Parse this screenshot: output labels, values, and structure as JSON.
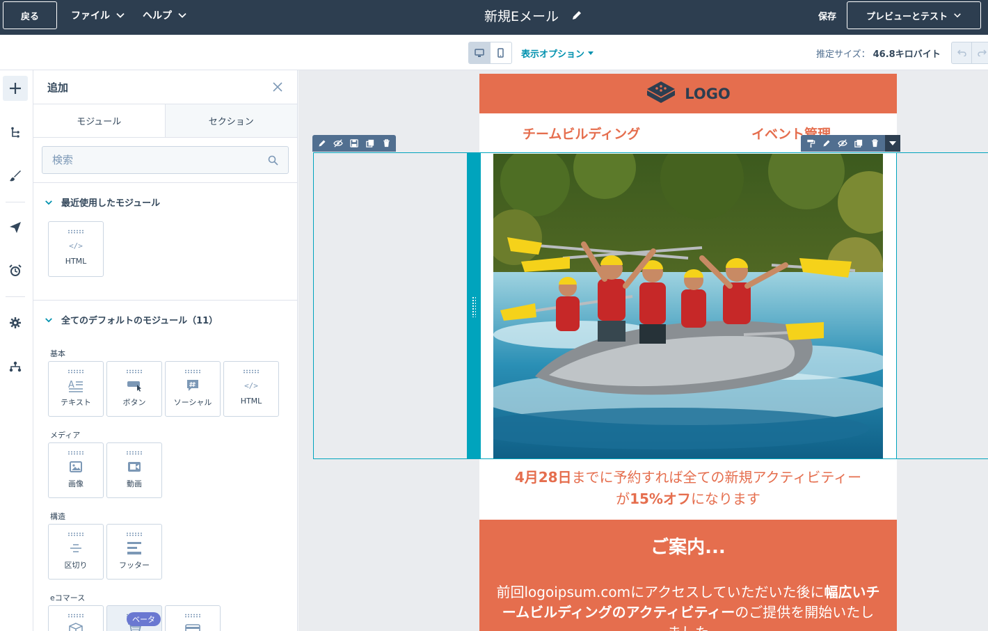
{
  "topbar": {
    "back_label": "戻る",
    "file_menu": "ファイル",
    "help_menu": "ヘルプ",
    "title": "新規Eメール",
    "save_label": "保存",
    "preview_label": "プレビューとテスト"
  },
  "toolbar": {
    "view_options": "表示オプション",
    "est_size_label": "推定サイズ：",
    "est_size_value": "46.8キロバイト",
    "active_device": "desktop"
  },
  "panel": {
    "title": "追加",
    "tabs": [
      "モジュール",
      "セクション"
    ],
    "active_tab": "モジュール",
    "search_placeholder": "検索",
    "recent": {
      "title": "最近使用したモジュール",
      "items": [
        {
          "label": "HTML",
          "icon": "code-icon"
        }
      ]
    },
    "all_defaults": {
      "title": "全てのデフォルトのモジュール（11）",
      "groups": [
        {
          "label": "基本",
          "items": [
            {
              "label": "テキスト",
              "icon": "text-icon"
            },
            {
              "label": "ボタン",
              "icon": "button-icon"
            },
            {
              "label": "ソーシャル",
              "icon": "social-icon"
            },
            {
              "label": "HTML",
              "icon": "code-icon"
            }
          ]
        },
        {
          "label": "メディア",
          "items": [
            {
              "label": "画像",
              "icon": "image-icon"
            },
            {
              "label": "動画",
              "icon": "video-icon"
            }
          ]
        },
        {
          "label": "構造",
          "items": [
            {
              "label": "区切り",
              "icon": "divider-icon"
            },
            {
              "label": "フッター",
              "icon": "footer-icon"
            }
          ]
        },
        {
          "label": "eコマース",
          "items": [
            {
              "label": "",
              "icon": "product-box-icon"
            },
            {
              "label": "",
              "icon": "cart-icon",
              "badge": "ベータ"
            },
            {
              "label": "",
              "icon": "payment-card-icon"
            }
          ]
        }
      ]
    }
  },
  "email": {
    "logo_text": "LOGO",
    "nav_links": [
      "チームビルディング",
      "イベント管理"
    ],
    "promo": {
      "p1_bold": "4月28日",
      "p1_rest": "までに予約すれば全ての新規アクティビティー",
      "p2_pre": "が",
      "p2_bold": "15%オフ",
      "p2_post": "になります"
    },
    "info": {
      "title": "ご案内...",
      "body_pre": "前回logoipsum.comにアクセスしていただいた後に",
      "body_bold": "幅広いチームビルディングのアクティビティー",
      "body_post": "のご提供を開始いたしました"
    }
  },
  "colors": {
    "topbar_bg": "#2d3e50",
    "accent_orange": "#e56e4e",
    "selection_teal": "#00a4bd",
    "link_teal": "#0091ae",
    "beta_purple": "#6a78d1"
  }
}
